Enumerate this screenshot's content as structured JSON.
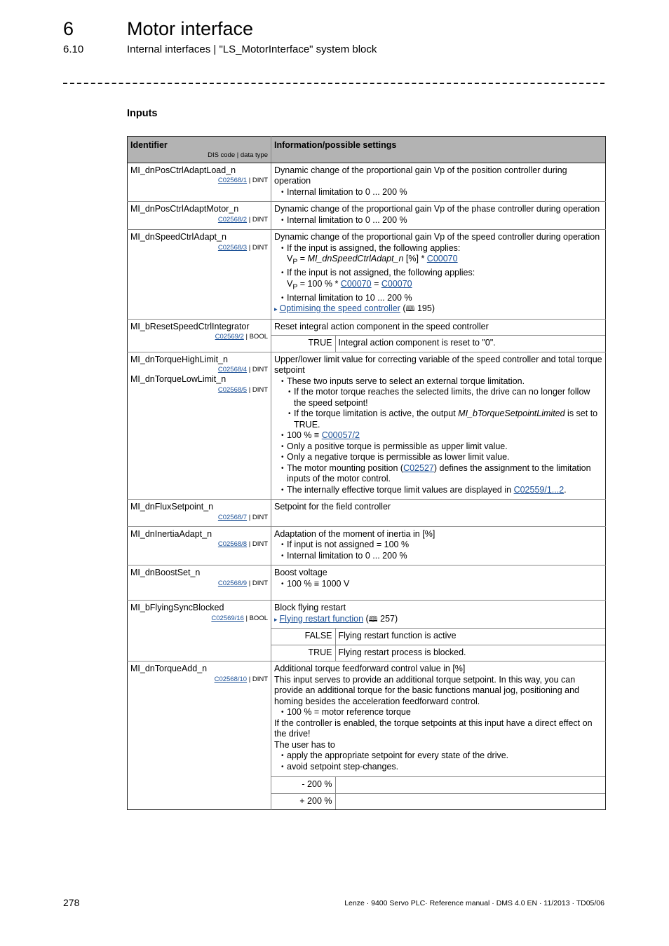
{
  "header": {
    "chapter_number": "6",
    "chapter_title": "Motor interface",
    "section_number": "6.10",
    "section_title": "Internal interfaces | \"LS_MotorInterface\" system block"
  },
  "inputs_heading": "Inputs",
  "table": {
    "col1_header": "Identifier",
    "col1_subheader": "DIS code | data type",
    "col2_header": "Information/possible settings",
    "rows": [
      {
        "identifier": "MI_dnPosCtrlAdaptLoad_n",
        "code": "C02568/1",
        "type": "DINT",
        "text": "Dynamic change of the proportional gain Vp of the position controller during operation",
        "bullets": [
          "Internal limitation to 0 ... 200 %"
        ]
      },
      {
        "identifier": "MI_dnPosCtrlAdaptMotor_n",
        "code": "C02568/2",
        "type": "DINT",
        "text": "Dynamic change of the proportional gain Vp of the phase controller during operation",
        "bullets": [
          "Internal limitation to 0 ... 200 %"
        ]
      },
      {
        "identifier": "MI_dnSpeedCtrlAdapt_n",
        "code": "C02568/3",
        "type": "DINT",
        "text": "Dynamic change of the proportional gain Vp of the speed controller during operation",
        "bullet1": "If the input is assigned, the following applies:",
        "formula1": {
          "vp": "V",
          "vp_sub": "P",
          "eq": " = ",
          "italic": "MI_dnSpeedCtrlAdapt_n",
          "rest": " [%] * ",
          "link": "C00070"
        },
        "bullet2": "If the input is not assigned, the following applies:",
        "formula2": {
          "vp": "V",
          "vp_sub": "P",
          "rest": " = 100 % * ",
          "link1": "C00070",
          "eq": " = ",
          "link2": "C00070"
        },
        "bullet3": "Internal limitation to 10 ... 200 %",
        "xref": {
          "label": "Optimising the speed controller",
          "page": "195"
        }
      },
      {
        "identifier": "MI_bResetSpeedCtrlIntegrator",
        "code": "C02569/2",
        "type": "BOOL",
        "text": "Reset integral action component in the speed controller",
        "values": [
          {
            "key": "TRUE",
            "desc": "Integral action component is reset to \"0\"."
          }
        ]
      },
      {
        "identifier": "MI_dnTorqueHighLimit_n",
        "code": "C02568/4",
        "type": "DINT",
        "identifier2": "MI_dnTorqueLowLimit_n",
        "code2": "C02568/5",
        "type2": "DINT",
        "text": "Upper/lower limit value for correcting variable of the speed controller and total torque setpoint",
        "bullet1": "These two inputs serve to select an external torque limitation.",
        "sub1": "If the motor torque reaches the selected limits, the drive can no longer follow the speed setpoint!",
        "sub2_pre": "If the torque limitation is active, the output ",
        "sub2_italic": "MI_bTorqueSetpointLimited",
        "sub2_post": " is set to TRUE.",
        "bullet2_pre": "100 % ≡ ",
        "bullet2_link": "C00057/2",
        "bullet3": "Only a positive torque is permissible as upper limit value.",
        "bullet4": "Only a negative torque is permissible as lower limit value.",
        "bullet5_pre": "The motor mounting position (",
        "bullet5_link": "C02527",
        "bullet5_post": ") defines the assignment to the limitation inputs of the motor control.",
        "bullet6_pre": "The internally effective torque limit values are displayed in ",
        "bullet6_link": "C02559/1...2",
        "bullet6_post": "."
      },
      {
        "identifier": "MI_dnFluxSetpoint_n",
        "code": "C02568/7",
        "type": "DINT",
        "text": "Setpoint for the field controller"
      },
      {
        "identifier": "MI_dnInertiaAdapt_n",
        "code": "C02568/8",
        "type": "DINT",
        "text": "Adaptation of the moment of inertia in [%]",
        "bullets": [
          "If input is not assigned = 100 %",
          "Internal limitation to 0 ... 200 %"
        ]
      },
      {
        "identifier": "MI_dnBoostSet_n",
        "code": "C02568/9",
        "type": "DINT",
        "text": "Boost voltage",
        "bullets": [
          "100 % ≡ 1000 V"
        ]
      },
      {
        "identifier": "MI_bFlyingSyncBlocked",
        "code": "C02569/16",
        "type": "BOOL",
        "text": "Block flying restart",
        "xref": {
          "label": "Flying restart function",
          "page": "257"
        },
        "values": [
          {
            "key": "FALSE",
            "desc": "Flying restart function is active"
          },
          {
            "key": "TRUE",
            "desc": "Flying restart process is blocked."
          }
        ]
      },
      {
        "identifier": "MI_dnTorqueAdd_n",
        "code": "C02568/10",
        "type": "DINT",
        "text": "Additional torque feedforward control value in [%]",
        "para1": "This input serves to provide an additional torque setpoint. In this way, you can provide an additional torque for the basic functions manual jog, positioning and homing besides the acceleration feedforward control.",
        "bullet1": "100 % = motor reference torque",
        "para2": "If the controller is enabled, the torque setpoints at this input have a direct effect on the drive!",
        "para3": "The user has to",
        "bullet2": "apply the appropriate setpoint for every state of the drive.",
        "bullet3": "avoid setpoint step-changes.",
        "values": [
          {
            "key": "- 200 %",
            "desc": ""
          },
          {
            "key": "+ 200 %",
            "desc": ""
          }
        ]
      }
    ]
  },
  "icons": {
    "xref_arrow": "▸",
    "book": "🕮"
  },
  "footer": {
    "page_number": "278",
    "text": "Lenze · 9400 Servo PLC· Reference manual · DMS 4.0 EN · 11/2013 · TD05/06"
  },
  "colors": {
    "link": "#1a4f96",
    "table_header_bg": "#b3b3b3"
  }
}
